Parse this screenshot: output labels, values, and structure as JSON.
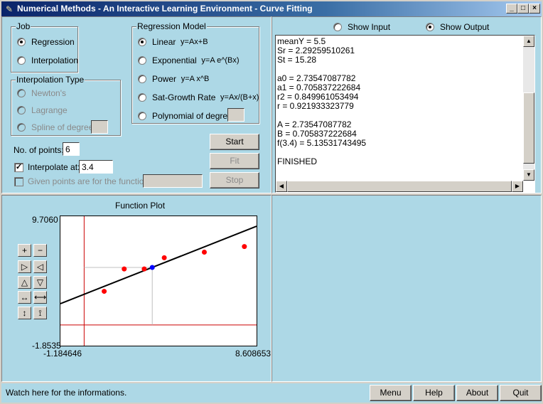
{
  "window": {
    "title": "Numerical Methods - An Interactive Learning Environment - Curve Fitting",
    "controls": [
      "_",
      "□",
      "×"
    ]
  },
  "job": {
    "legend": "Job",
    "options": [
      {
        "label": "Regression",
        "selected": true
      },
      {
        "label": "Interpolation",
        "selected": false
      }
    ]
  },
  "regression_model": {
    "legend": "Regression Model",
    "options": [
      {
        "label": "Linear",
        "formula": "y=Ax+B",
        "selected": true
      },
      {
        "label": "Exponential",
        "formula": "y=A e^(Bx)",
        "selected": false
      },
      {
        "label": "Power",
        "formula": "y=A x^B",
        "selected": false
      },
      {
        "label": "Sat-Growth Rate",
        "formula": "y=Ax/(B+x)",
        "selected": false
      },
      {
        "label": "Polynomial of degree",
        "formula": "",
        "selected": false
      }
    ]
  },
  "interpolation_type": {
    "legend": "Interpolation Type",
    "options": [
      {
        "label": "Newton's"
      },
      {
        "label": "Lagrange"
      },
      {
        "label": "Spline of degree"
      }
    ]
  },
  "points": {
    "label": "No. of points:",
    "value": "6"
  },
  "interpolate_at": {
    "label": "Interpolate at:",
    "checked": true,
    "value": "3.4"
  },
  "given_points": {
    "label": "Given points are for the function:",
    "checked": false,
    "value": ""
  },
  "actions": {
    "start": "Start",
    "fit": "Fit",
    "stop": "Stop"
  },
  "view": {
    "show_input": "Show Input",
    "show_output": "Show Output",
    "selected": "output"
  },
  "output_text": "meanY = 5.5\nSr = 2.29259510261\nSt = 15.28\n\na0 = 2.73547087782\na1 = 0.705837222684\nr2 = 0.849961053494\nr = 0.921933323779\n\nA = 2.73547087782\nB = 0.705837222684\nf(3.4) = 5.13531743495\n\nFINISHED",
  "plot_tools": [
    "+",
    "−",
    "▷",
    "◁",
    "△",
    "▽",
    "↔",
    "⟷",
    "↕",
    "⟟"
  ],
  "chart_data": {
    "type": "scatter",
    "title": "Function Plot",
    "xlim": [
      -1.184646,
      8.608653
    ],
    "ylim": [
      -1.8535,
      9.706
    ],
    "xmin_label": "-1.184646",
    "xmax_label": "8.608653",
    "ymin_label": "-1.8535",
    "ymax_label": "9.7060",
    "points": [
      [
        1,
        3
      ],
      [
        2,
        5
      ],
      [
        3,
        5
      ],
      [
        4,
        6
      ],
      [
        6,
        6.5
      ],
      [
        8,
        7
      ]
    ],
    "interpolated_point": [
      3.4,
      5.135
    ],
    "fit": {
      "a0": 2.73547087782,
      "a1": 0.705837222684
    },
    "colors": {
      "points": "#ff0000",
      "interp": "#0000ff",
      "fit": "#000000",
      "axes": "#cc0000",
      "guides": "#c0c0c0"
    }
  },
  "status": {
    "message": "Watch here for the informations."
  },
  "footer_buttons": [
    "Menu",
    "Help",
    "About",
    "Quit"
  ]
}
